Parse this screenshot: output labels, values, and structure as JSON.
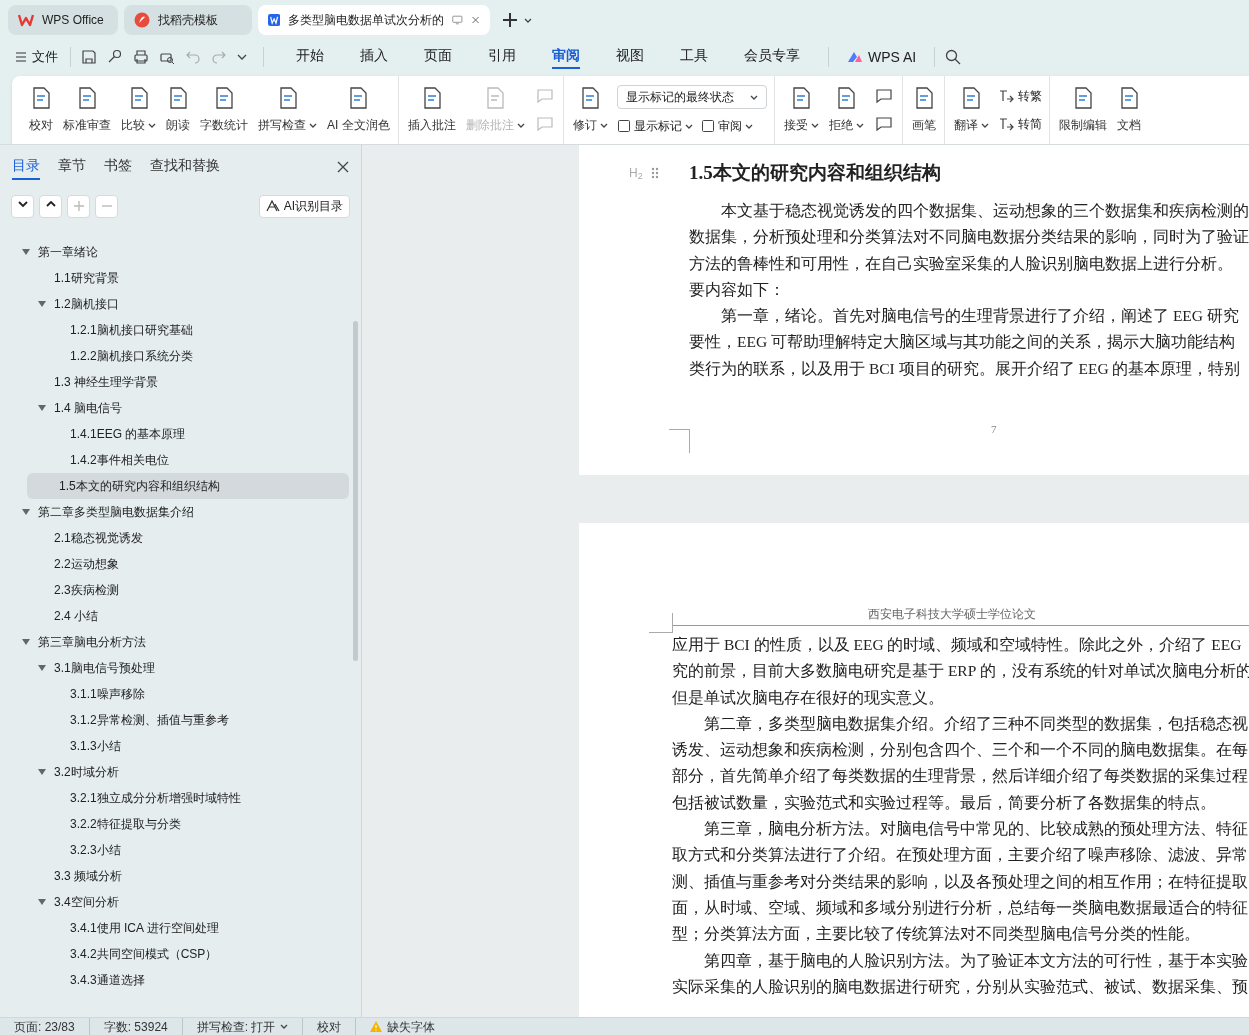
{
  "tabs": [
    {
      "label": "WPS Office",
      "selected": false,
      "kind": "home"
    },
    {
      "label": "找稻壳模板",
      "selected": false,
      "kind": "template"
    },
    {
      "label": "多类型脑电数据单试次分析的",
      "selected": true,
      "kind": "doc"
    }
  ],
  "menu": {
    "file": "文件",
    "tabs": [
      {
        "label": "开始",
        "selected": false
      },
      {
        "label": "插入",
        "selected": false
      },
      {
        "label": "页面",
        "selected": false
      },
      {
        "label": "引用",
        "selected": false
      },
      {
        "label": "审阅",
        "selected": true
      },
      {
        "label": "视图",
        "selected": false
      },
      {
        "label": "工具",
        "selected": false
      },
      {
        "label": "会员专享",
        "selected": false
      }
    ],
    "ai": "WPS AI"
  },
  "ribbon": [
    [
      {
        "kind": "big",
        "label": "校对",
        "dropdown": false,
        "disabled": false
      },
      {
        "kind": "big",
        "label": "标准审查",
        "dropdown": false,
        "disabled": false
      },
      {
        "kind": "big",
        "label": "比较",
        "dropdown": true,
        "disabled": false
      },
      {
        "kind": "big",
        "label": "朗读",
        "dropdown": false,
        "disabled": false
      },
      {
        "kind": "big",
        "label": "字数统计",
        "dropdown": false,
        "disabled": false
      },
      {
        "kind": "big",
        "label": "拼写检查",
        "dropdown": true,
        "disabled": false
      },
      {
        "kind": "big",
        "label": "AI 全文润色",
        "dropdown": false,
        "disabled": false
      }
    ],
    [
      {
        "kind": "big",
        "label": "插入批注",
        "dropdown": false,
        "disabled": false
      },
      {
        "kind": "big",
        "label": "删除批注",
        "dropdown": true,
        "disabled": true
      },
      {
        "kind": "pair",
        "disabled": true
      }
    ],
    [
      {
        "kind": "big",
        "label": "修订",
        "dropdown": true,
        "disabled": false
      },
      {
        "kind": "markup",
        "value": "显示标记的最终状态",
        "buttons": [
          {
            "label": "显示标记"
          },
          {
            "label": "审阅"
          }
        ]
      }
    ],
    [
      {
        "kind": "big",
        "label": "接受",
        "dropdown": true,
        "disabled": false
      },
      {
        "kind": "big",
        "label": "拒绝",
        "dropdown": true,
        "disabled": false
      },
      {
        "kind": "pair",
        "disabled": false
      }
    ],
    [
      {
        "kind": "big",
        "label": "画笔",
        "dropdown": false,
        "disabled": false
      }
    ],
    [
      {
        "kind": "big",
        "label": "翻译",
        "dropdown": true,
        "disabled": false
      },
      {
        "kind": "stack",
        "buttons": [
          {
            "label": "转繁"
          },
          {
            "label": "转简"
          }
        ]
      }
    ],
    [
      {
        "kind": "big",
        "label": "限制编辑",
        "dropdown": false,
        "disabled": false
      },
      {
        "kind": "big",
        "label": "文档",
        "dropdown": false,
        "disabled": false
      }
    ]
  ],
  "sidebar": {
    "tabs": [
      {
        "label": "目录",
        "selected": true
      },
      {
        "label": "章节",
        "selected": false
      },
      {
        "label": "书签",
        "selected": false
      },
      {
        "label": "查找和替换",
        "selected": false
      }
    ],
    "ai_button": "AI识别目录",
    "tree": [
      {
        "label": "第一章绪论",
        "expanded": true,
        "selected": false,
        "children": [
          {
            "label": "1.1研究背景",
            "selected": false
          },
          {
            "label": "1.2脑机接口",
            "expanded": true,
            "selected": false,
            "children": [
              {
                "label": "1.2.1脑机接口研究基础",
                "selected": false
              },
              {
                "label": "1.2.2脑机接口系统分类",
                "selected": false
              }
            ]
          },
          {
            "label": "1.3  神经生理学背景",
            "selected": false
          },
          {
            "label": "1.4  脑电信号",
            "expanded": true,
            "selected": false,
            "children": [
              {
                "label": "1.4.1EEG 的基本原理",
                "selected": false
              },
              {
                "label": "1.4.2事件相关电位",
                "selected": false
              }
            ]
          },
          {
            "label": "1.5本文的研究内容和组织结构",
            "selected": true
          }
        ]
      },
      {
        "label": "第二章多类型脑电数据集介绍",
        "expanded": true,
        "selected": false,
        "children": [
          {
            "label": "2.1稳态视觉诱发",
            "selected": false
          },
          {
            "label": "2.2运动想象",
            "selected": false
          },
          {
            "label": "2.3疾病检测",
            "selected": false
          },
          {
            "label": "2.4  小结",
            "selected": false
          }
        ]
      },
      {
        "label": "第三章脑电分析方法",
        "expanded": true,
        "selected": false,
        "children": [
          {
            "label": "3.1脑电信号预处理",
            "expanded": true,
            "selected": false,
            "children": [
              {
                "label": "3.1.1噪声移除",
                "selected": false
              },
              {
                "label": "3.1.2异常检测、插值与重参考",
                "selected": false
              },
              {
                "label": "3.1.3小结",
                "selected": false
              }
            ]
          },
          {
            "label": "3.2时域分析",
            "expanded": true,
            "selected": false,
            "children": [
              {
                "label": "3.2.1独立成分分析增强时域特性",
                "selected": false
              },
              {
                "label": "3.2.2特征提取与分类",
                "selected": false
              },
              {
                "label": "3.2.3小结",
                "selected": false
              }
            ]
          },
          {
            "label": "3.3  频域分析",
            "selected": false
          },
          {
            "label": "3.4空间分析",
            "expanded": true,
            "selected": false,
            "children": [
              {
                "label": "3.4.1使用 ICA 进行空间处理",
                "selected": false
              },
              {
                "label": "3.4.2共同空间模式（CSP）",
                "selected": false
              },
              {
                "label": "3.4.3通道选择",
                "selected": false
              }
            ]
          }
        ]
      }
    ]
  },
  "page1": {
    "heading_marker": "H$_{2}$",
    "heading": "1.5本文的研究内容和组织结构",
    "lines": [
      {
        "text": "本文基于稳态视觉诱发的四个数据集、运动想象的三个数据集和疾病检测的",
        "indent": true
      },
      {
        "text": "数据集，分析预处理和分类算法对不同脑电数据分类结果的影响，同时为了验证",
        "indent": false
      },
      {
        "text": "方法的鲁棒性和可用性，在自己实验室采集的人脸识别脑电数据上进行分析。",
        "indent": false
      },
      {
        "text": "要内容如下：",
        "indent": false
      },
      {
        "text": "第一章，绪论。首先对脑电信号的生理背景进行了介绍，阐述了 EEG 研究",
        "indent": true
      },
      {
        "text": "要性，EEG 可帮助理解特定大脑区域与其功能之间的关系，揭示大脑功能结构",
        "indent": false
      },
      {
        "text": "类行为的联系，以及用于 BCI 项目的研究。展开介绍了 EEG 的基本原理，特别",
        "indent": false
      }
    ],
    "page_number": "7"
  },
  "page2": {
    "header": "西安电子科技大学硕士学位论文",
    "lines": [
      {
        "text": "应用于 BCI 的性质，以及 EEG 的时域、频域和空域特性。除此之外，介绍了 EEG",
        "indent": false
      },
      {
        "text": "究的前景，目前大多数脑电研究是基于 ERP 的，没有系统的针对单试次脑电分析的",
        "indent": false
      },
      {
        "text": "但是单试次脑电存在很好的现实意义。",
        "indent": false
      },
      {
        "text": "第二章，多类型脑电数据集介绍。介绍了三种不同类型的数据集，包括稳态视",
        "indent": true
      },
      {
        "text": "诱发、运动想象和疾病检测，分别包含四个、三个和一个不同的脑电数据集。在每",
        "indent": false
      },
      {
        "text": "部分，首先简单介绍了每类数据的生理背景，然后详细介绍了每类数据的采集过程",
        "indent": false
      },
      {
        "text": "包括被试数量，实验范式和实验过程等。最后，简要分析了各数据集的特点。",
        "indent": false
      },
      {
        "text": "第三章，脑电分析方法。对脑电信号中常见的、比较成熟的预处理方法、特征",
        "indent": true
      },
      {
        "text": "取方式和分类算法进行了介绍。在预处理方面，主要介绍了噪声移除、滤波、异常",
        "indent": false
      },
      {
        "text": "测、插值与重参考对分类结果的影响，以及各预处理之间的相互作用；在特征提取",
        "indent": false
      },
      {
        "text": "面，从时域、空域、频域和多域分别进行分析，总结每一类脑电数据最适合的特征",
        "indent": false
      },
      {
        "text": "型；分类算法方面，主要比较了传统算法对不同类型脑电信号分类的性能。",
        "indent": false
      },
      {
        "text": "第四章，基于脑电的人脸识别方法。为了验证本文方法的可行性，基于本实验",
        "indent": true
      },
      {
        "text": "实际采集的人脸识别的脑电数据进行研究，分别从实验范式、被试、数据采集、预",
        "indent": false
      }
    ]
  },
  "status_bar": [
    {
      "text": "页面: 23/83",
      "kind": "text"
    },
    {
      "text": "字数: 53924",
      "kind": "text"
    },
    {
      "text": "拼写检查: 打开",
      "kind": "dropdown"
    },
    {
      "text": "校对",
      "kind": "text"
    },
    {
      "text": "缺失字体",
      "kind": "warning"
    }
  ]
}
